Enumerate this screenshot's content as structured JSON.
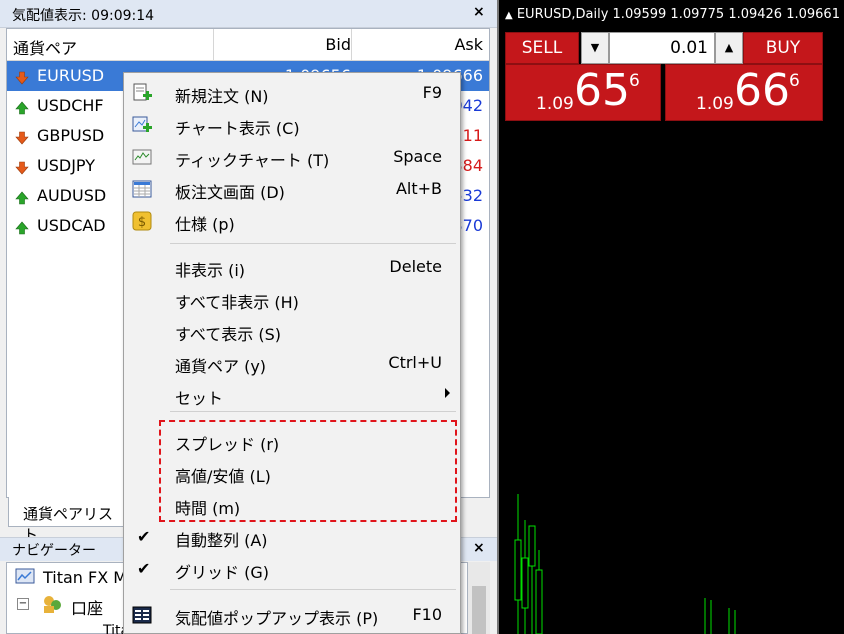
{
  "market_watch": {
    "title": "気配値表示: 09:09:14",
    "close_glyph": "×",
    "columns": {
      "symbol": "通貨ペア",
      "bid": "Bid",
      "ask": "Ask"
    },
    "rows": [
      {
        "symbol": "EURUSD",
        "bid": "1.09656",
        "ask": "1.09666",
        "direction": "down",
        "selected": true
      },
      {
        "symbol": "USDCHF",
        "bid": "",
        "ask": "042",
        "direction": "up",
        "ask_color": "#1a3ad6"
      },
      {
        "symbol": "GBPUSD",
        "bid": "",
        "ask": "211",
        "direction": "down",
        "ask_color": "#d61a1a"
      },
      {
        "symbol": "USDJPY",
        "bid": "",
        "ask": "384",
        "direction": "down",
        "ask_color": "#d61a1a"
      },
      {
        "symbol": "AUDUSD",
        "bid": "",
        "ask": "532",
        "direction": "up",
        "ask_color": "#1a3ad6"
      },
      {
        "symbol": "USDCAD",
        "bid": "",
        "ask": "370",
        "direction": "up",
        "ask_color": "#1a3ad6"
      }
    ],
    "tab_label": "通貨ペアリスト"
  },
  "navigator": {
    "title": "ナビゲーター",
    "close_glyph": "×",
    "items": [
      "Titan FX M",
      "口座",
      "Titan FX Limited"
    ]
  },
  "chart": {
    "title": "EURUSD,Daily  1.09599 1.09775 1.09426 1.09661",
    "sell_label": "SELL",
    "buy_label": "BUY",
    "lot_value": "0.01",
    "sell_quote": {
      "prefix": "1.09",
      "big": "65",
      "sup": "6"
    },
    "buy_quote": {
      "prefix": "1.09",
      "big": "66",
      "sup": "6"
    },
    "colors": {
      "button_red": "#c4171b",
      "candle_green": "#00e000"
    }
  },
  "context_menu": {
    "items": [
      {
        "label": "新規注文 (N)",
        "shortcut": "F9",
        "icon": "new-order-icon"
      },
      {
        "label": "チャート表示 (C)",
        "shortcut": "",
        "icon": "chart-window-icon"
      },
      {
        "label": "ティックチャート (T)",
        "shortcut": "Space",
        "icon": "tick-chart-icon"
      },
      {
        "label": "板注文画面 (D)",
        "shortcut": "Alt+B",
        "icon": "depth-of-market-icon"
      },
      {
        "label": "仕様 (p)",
        "shortcut": "",
        "icon": "specification-icon"
      },
      {
        "label": "非表示 (i)",
        "shortcut": "Delete"
      },
      {
        "label": "すべて非表示 (H)",
        "shortcut": ""
      },
      {
        "label": "すべて表示 (S)",
        "shortcut": ""
      },
      {
        "label": "通貨ペア (y)",
        "shortcut": "Ctrl+U"
      },
      {
        "label": "セット",
        "shortcut": "",
        "submenu": true
      },
      {
        "label": "スプレッド (r)",
        "shortcut": ""
      },
      {
        "label": "高値/安値 (L)",
        "shortcut": ""
      },
      {
        "label": "時間 (m)",
        "shortcut": ""
      },
      {
        "label": "自動整列 (A)",
        "shortcut": "",
        "checked": true
      },
      {
        "label": "グリッド (G)",
        "shortcut": "",
        "checked": true
      },
      {
        "label": "気配値ポップアップ表示 (P)",
        "shortcut": "F10",
        "icon": "popup-prices-icon"
      }
    ],
    "check_glyph": "✔",
    "highlight_color": "#e0141b"
  }
}
